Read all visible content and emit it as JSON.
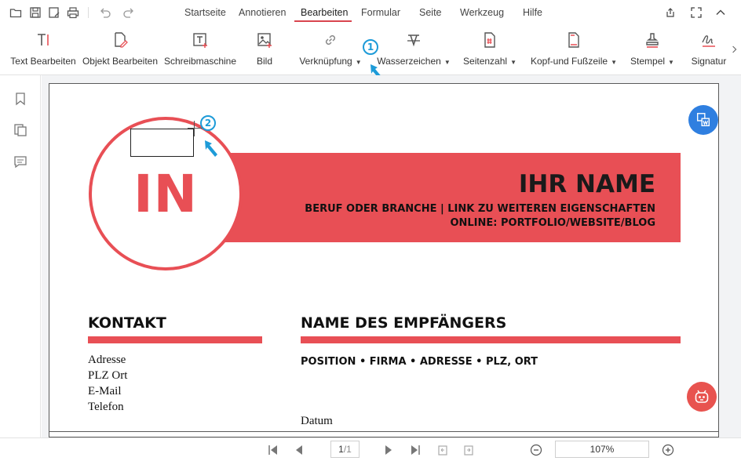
{
  "menu": {
    "tabs": [
      "Startseite",
      "Annotieren",
      "Bearbeiten",
      "Formular",
      "Seite",
      "Werkzeug",
      "Hilfe"
    ],
    "active_tab": "Bearbeiten"
  },
  "ribbon": {
    "items": [
      {
        "label": "Text Bearbeiten",
        "icon": "text-edit-icon",
        "dropdown": false
      },
      {
        "label": "Objekt Bearbeiten",
        "icon": "object-edit-icon",
        "dropdown": false
      },
      {
        "label": "Schreibmaschine",
        "icon": "typewriter-icon",
        "dropdown": false
      },
      {
        "label": "Bild",
        "icon": "image-icon",
        "dropdown": false
      },
      {
        "label": "Verknüpfung",
        "icon": "link-icon",
        "dropdown": true
      },
      {
        "label": "Wasserzeichen",
        "icon": "watermark-icon",
        "dropdown": true
      },
      {
        "label": "Seitenzahl",
        "icon": "page-number-icon",
        "dropdown": true
      },
      {
        "label": "Kopf-und Fußzeile",
        "icon": "header-footer-icon",
        "dropdown": true
      },
      {
        "label": "Stempel",
        "icon": "stamp-icon",
        "dropdown": true
      },
      {
        "label": "Signatur",
        "icon": "signature-icon",
        "dropdown": false
      }
    ],
    "active_item": "Verknüpfung"
  },
  "document": {
    "initials": "IN",
    "name": "IHR NAME",
    "subtitle_line1": "BERUF ODER BRANCHE | LINK ZU WEITEREN EIGENSCHAFTEN",
    "subtitle_line2": "ONLINE: PORTFOLIO/WEBSITE/BLOG",
    "contact_heading": "KONTAKT",
    "contact_lines": [
      "Adresse",
      "PLZ Ort",
      "E-Mail",
      "Telefon"
    ],
    "recipient_heading": "NAME DES EMPFÄNGERS",
    "recipient_details": "POSITION • FIRMA • ADRESSE • PLZ, ORT",
    "date_label": "Datum"
  },
  "annotations": {
    "step1": "1",
    "step2": "2"
  },
  "status": {
    "page": "1",
    "total": "/1",
    "zoom": "107%"
  },
  "colors": {
    "accent": "#e84f55",
    "tab_underline": "#d9454f",
    "annotation": "#1d9bd8",
    "convert_button": "#2f7fe0",
    "ai_button": "#e8534f"
  }
}
